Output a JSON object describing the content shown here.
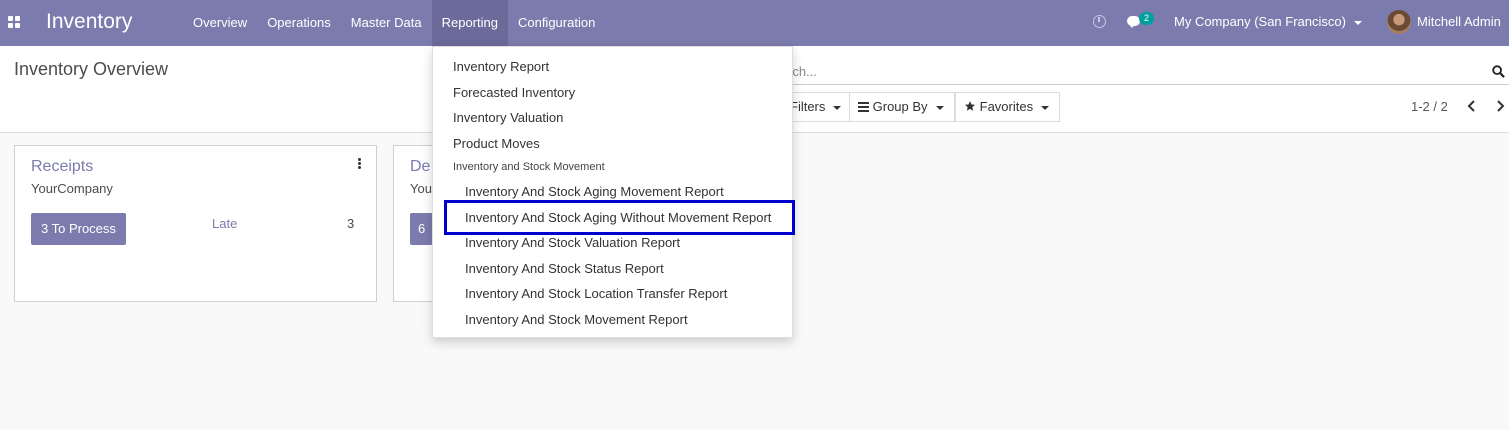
{
  "navbar": {
    "app_name": "Inventory",
    "menu": [
      {
        "label": "Overview"
      },
      {
        "label": "Operations"
      },
      {
        "label": "Master Data"
      },
      {
        "label": "Reporting"
      },
      {
        "label": "Configuration"
      }
    ],
    "chat_count": "2",
    "company": "My Company (San Francisco)",
    "user": "Mitchell Admin"
  },
  "control_panel": {
    "title": "Inventory Overview",
    "search_placeholder": "rch...",
    "filters_label": "Filters",
    "groupby_label": "Group By",
    "favorites_label": "Favorites",
    "pager": "1-2 / 2"
  },
  "cards": [
    {
      "title": "Receipts",
      "company": "YourCompany",
      "process_label": "3 To Process",
      "late_label": "Late",
      "late_count": "3"
    },
    {
      "title": "De",
      "company": "You",
      "process_label": "6"
    }
  ],
  "reporting_menu": {
    "items": [
      "Inventory Report",
      "Forecasted Inventory",
      "Inventory Valuation",
      "Product Moves"
    ],
    "section_header": "Inventory and Stock Movement",
    "sub_items": [
      "Inventory And Stock Aging Movement Report",
      "Inventory And Stock Aging Without Movement Report",
      "Inventory And Stock Valuation Report",
      "Inventory And Stock Status Report",
      "Inventory And Stock Location Transfer Report",
      "Inventory And Stock Movement Report"
    ]
  },
  "colors": {
    "navbar": "#7c7bad",
    "highlight_border": "#0000cc",
    "badge": "#00a09d"
  },
  "icons": [
    "apps-icon",
    "clock-icon",
    "chat-icon",
    "search-icon",
    "star-icon",
    "list-icon",
    "chevron-left-icon",
    "chevron-right-icon",
    "kebab-icon"
  ]
}
